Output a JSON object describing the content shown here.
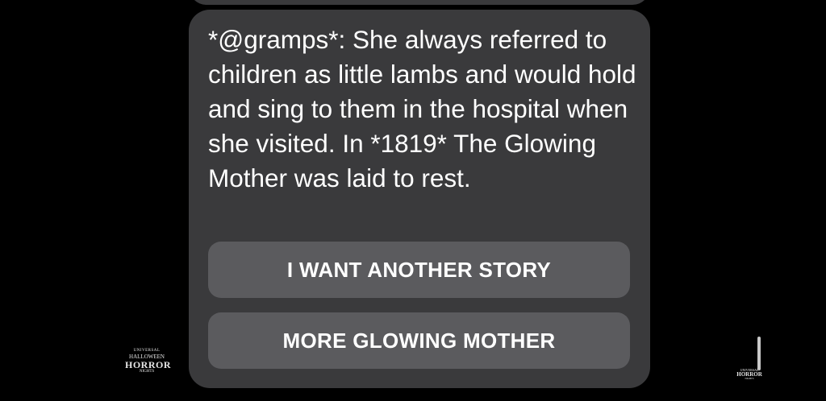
{
  "message": {
    "text": "*@gramps*: She always referred to children as little lambs and would hold and sing to them in the hospital when she visited. In *1819* The Glowing Mother was laid to rest."
  },
  "quick_replies": [
    {
      "label": "I WANT ANOTHER STORY"
    },
    {
      "label": "MORE GLOWING MOTHER"
    }
  ],
  "watermark": {
    "line1": "UNIVERSAL",
    "line2": "HALLOWEEN",
    "line3": "HORROR",
    "line4": "NIGHTS"
  },
  "colors": {
    "background": "#000000",
    "bubble": "#3a3a3c",
    "button": "#5b5b5e",
    "text": "#ffffff"
  }
}
